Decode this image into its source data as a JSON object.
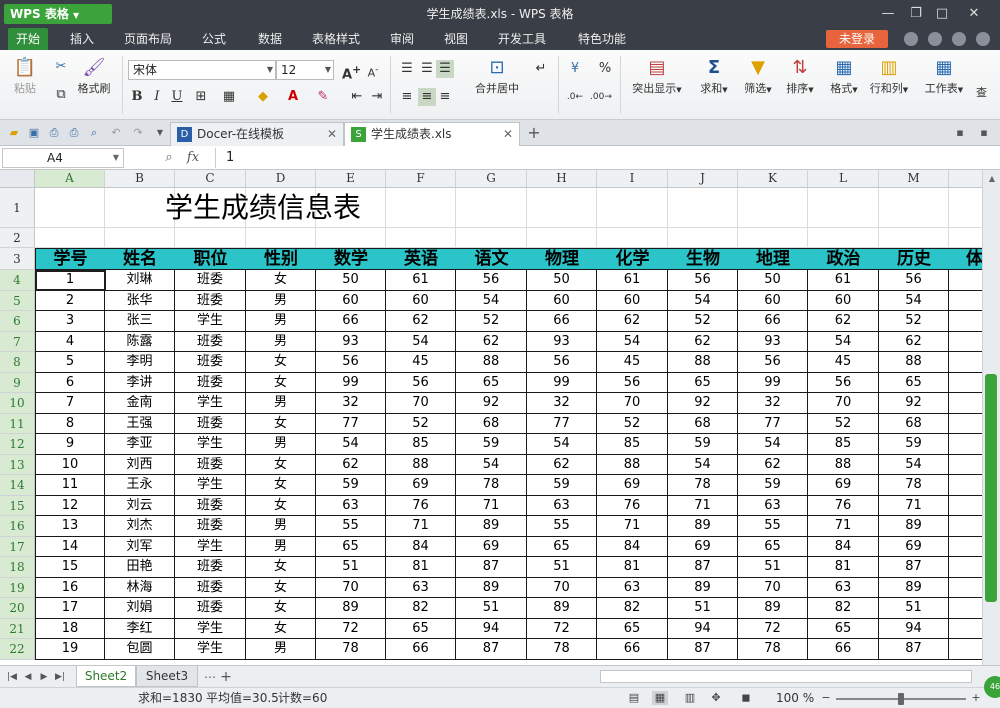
{
  "app": {
    "logo_label": "WPS 表格",
    "window_title": "学生成绩表.xls - WPS 表格"
  },
  "menu": [
    {
      "label": "开始",
      "active": true
    },
    {
      "label": "插入"
    },
    {
      "label": "页面布局"
    },
    {
      "label": "公式"
    },
    {
      "label": "数据"
    },
    {
      "label": "表格样式"
    },
    {
      "label": "审阅"
    },
    {
      "label": "视图"
    },
    {
      "label": "开发工具"
    },
    {
      "label": "特色功能"
    }
  ],
  "login_label": "未登录",
  "ribbon": {
    "paste": "粘贴",
    "format_painter": "格式刷",
    "font_name": "宋体",
    "font_size": "12",
    "bold": "B",
    "italic": "I",
    "underline": "U",
    "merge_center": "合并居中",
    "highlight": "突出显示",
    "sum": "求和",
    "filter": "筛选",
    "sort": "排序",
    "format": "格式",
    "row_col": "行和列",
    "worksheet": "工作表",
    "percent": "%",
    "font_grow": "A",
    "font_shrink": "A",
    "font_color": "A",
    "trailing": "查"
  },
  "tabs": [
    {
      "label": "Docer-在线模板",
      "active": false
    },
    {
      "label": "学生成绩表.xls",
      "active": true
    }
  ],
  "formula_bar": {
    "cell_ref": "A4",
    "fx": "fx",
    "value": "1"
  },
  "columns": [
    "A",
    "B",
    "C",
    "D",
    "E",
    "F",
    "G",
    "H",
    "I",
    "J",
    "K",
    "L",
    "M"
  ],
  "row_numbers": [
    "1",
    "2",
    "3",
    "4",
    "5",
    "6",
    "7",
    "8",
    "9",
    "10",
    "11",
    "12",
    "13",
    "14",
    "15",
    "16",
    "17",
    "18",
    "19",
    "20",
    "21",
    "22"
  ],
  "sheet": {
    "title": "学生成绩信息表",
    "headers": [
      "学号",
      "姓名",
      "职位",
      "性别",
      "数学",
      "英语",
      "语文",
      "物理",
      "化学",
      "生物",
      "地理",
      "政治",
      "历史",
      "体"
    ],
    "rows": [
      [
        "1",
        "刘琳",
        "班委",
        "女",
        "50",
        "61",
        "56",
        "50",
        "61",
        "56",
        "50",
        "61",
        "56"
      ],
      [
        "2",
        "张华",
        "班委",
        "男",
        "60",
        "60",
        "54",
        "60",
        "60",
        "54",
        "60",
        "60",
        "54"
      ],
      [
        "3",
        "张三",
        "学生",
        "男",
        "66",
        "62",
        "52",
        "66",
        "62",
        "52",
        "66",
        "62",
        "52"
      ],
      [
        "4",
        "陈露",
        "班委",
        "男",
        "93",
        "54",
        "62",
        "93",
        "54",
        "62",
        "93",
        "54",
        "62"
      ],
      [
        "5",
        "李明",
        "班委",
        "女",
        "56",
        "45",
        "88",
        "56",
        "45",
        "88",
        "56",
        "45",
        "88"
      ],
      [
        "6",
        "李讲",
        "班委",
        "女",
        "99",
        "56",
        "65",
        "99",
        "56",
        "65",
        "99",
        "56",
        "65"
      ],
      [
        "7",
        "金南",
        "学生",
        "男",
        "32",
        "70",
        "92",
        "32",
        "70",
        "92",
        "32",
        "70",
        "92"
      ],
      [
        "8",
        "王强",
        "班委",
        "女",
        "77",
        "52",
        "68",
        "77",
        "52",
        "68",
        "77",
        "52",
        "68"
      ],
      [
        "9",
        "李亚",
        "学生",
        "男",
        "54",
        "85",
        "59",
        "54",
        "85",
        "59",
        "54",
        "85",
        "59"
      ],
      [
        "10",
        "刘西",
        "班委",
        "女",
        "62",
        "88",
        "54",
        "62",
        "88",
        "54",
        "62",
        "88",
        "54"
      ],
      [
        "11",
        "王永",
        "学生",
        "女",
        "59",
        "69",
        "78",
        "59",
        "69",
        "78",
        "59",
        "69",
        "78"
      ],
      [
        "12",
        "刘云",
        "班委",
        "女",
        "63",
        "76",
        "71",
        "63",
        "76",
        "71",
        "63",
        "76",
        "71"
      ],
      [
        "13",
        "刘杰",
        "班委",
        "男",
        "55",
        "71",
        "89",
        "55",
        "71",
        "89",
        "55",
        "71",
        "89"
      ],
      [
        "14",
        "刘军",
        "学生",
        "男",
        "65",
        "84",
        "69",
        "65",
        "84",
        "69",
        "65",
        "84",
        "69"
      ],
      [
        "15",
        "田艳",
        "班委",
        "女",
        "51",
        "81",
        "87",
        "51",
        "81",
        "87",
        "51",
        "81",
        "87"
      ],
      [
        "16",
        "林海",
        "班委",
        "女",
        "70",
        "63",
        "89",
        "70",
        "63",
        "89",
        "70",
        "63",
        "89"
      ],
      [
        "17",
        "刘娟",
        "班委",
        "女",
        "89",
        "82",
        "51",
        "89",
        "82",
        "51",
        "89",
        "82",
        "51"
      ],
      [
        "18",
        "李红",
        "学生",
        "女",
        "72",
        "65",
        "94",
        "72",
        "65",
        "94",
        "72",
        "65",
        "94"
      ],
      [
        "19",
        "包圆",
        "学生",
        "男",
        "78",
        "66",
        "87",
        "78",
        "66",
        "87",
        "78",
        "66",
        "87"
      ]
    ]
  },
  "sheet_tabs": [
    {
      "label": "Sheet2",
      "active": true
    },
    {
      "label": "Sheet3",
      "active": false
    }
  ],
  "status": {
    "sum": "求和=1830",
    "avg": "平均值=30.5",
    "count": "计数=60",
    "zoom": "100 %",
    "zoom_level": 1.0
  }
}
